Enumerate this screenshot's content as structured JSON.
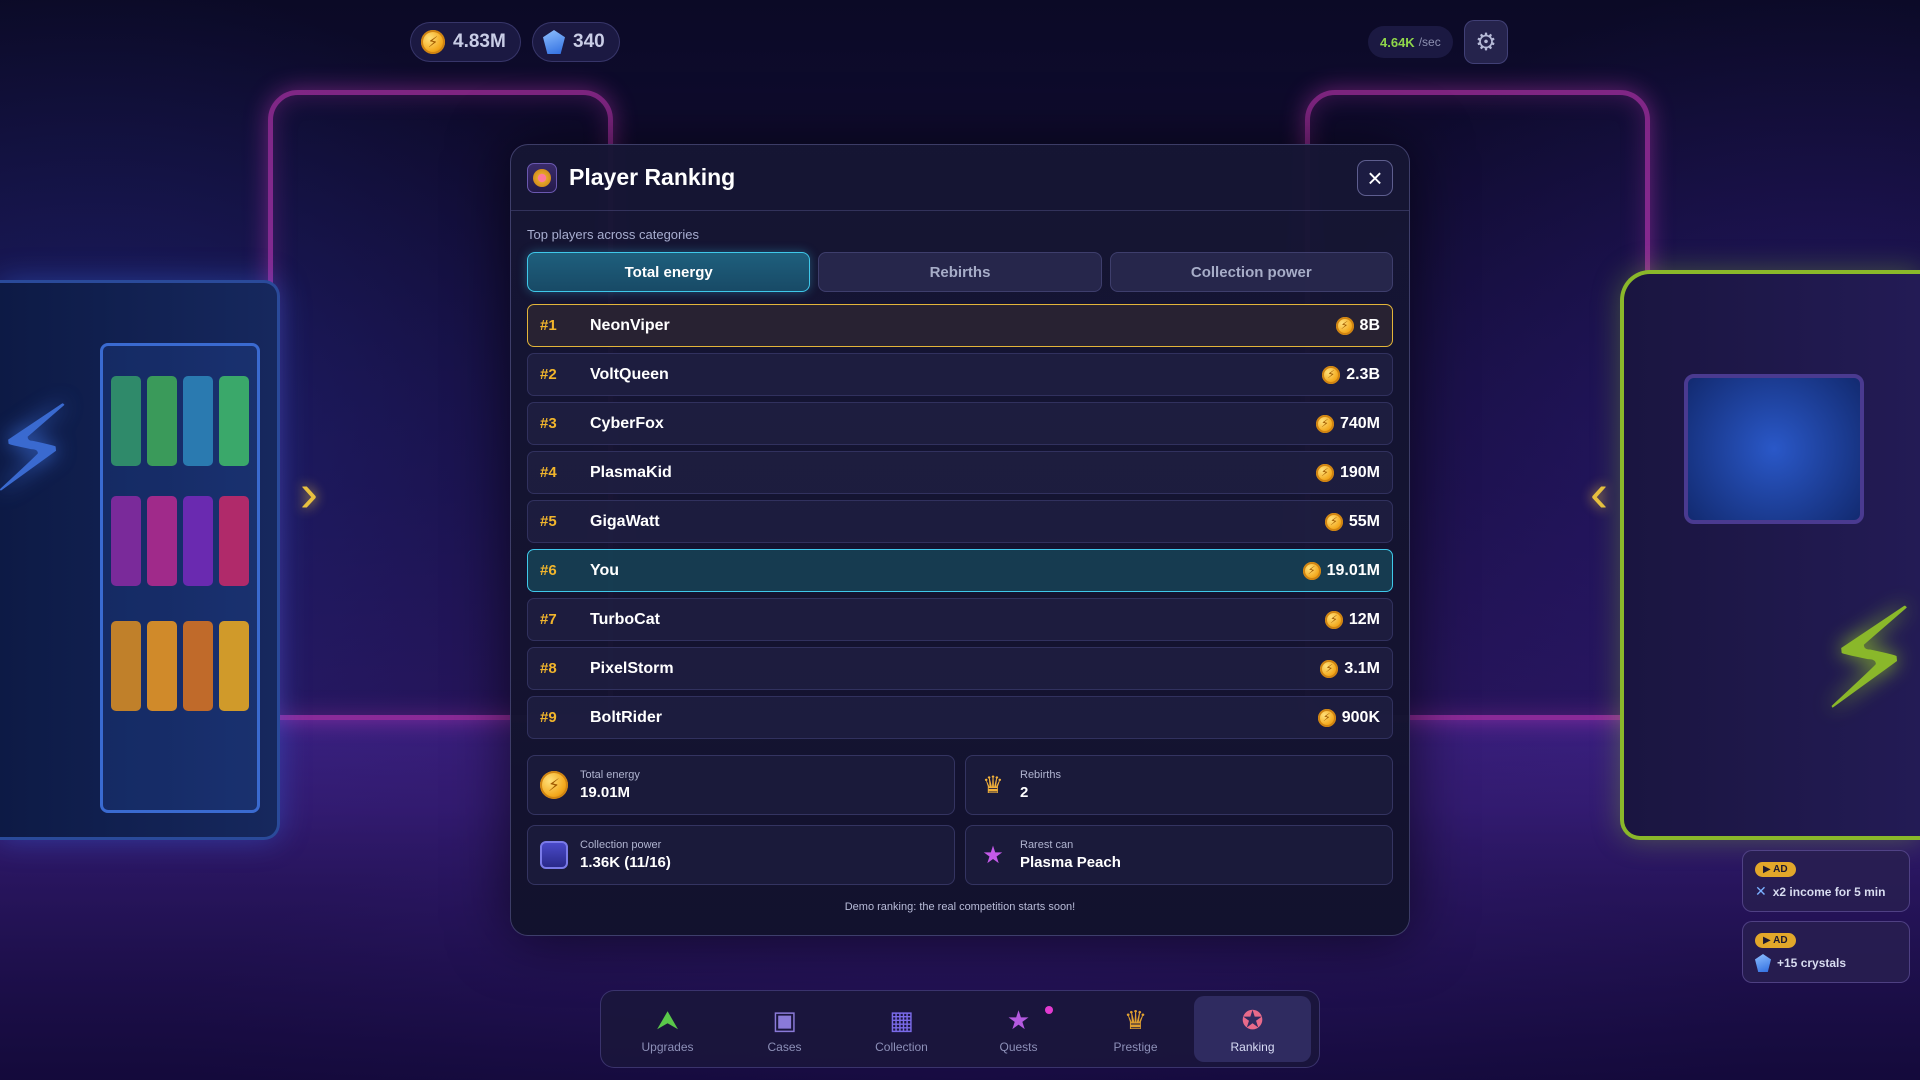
{
  "hud": {
    "coins": "4.83M",
    "crystals": "340",
    "rate_value": "4.64K",
    "rate_unit": "/sec",
    "settings_icon": "gear-icon"
  },
  "modal": {
    "title": "Player Ranking",
    "subtitle": "Top players across categories",
    "tabs": [
      {
        "label": "Total energy",
        "active": true
      },
      {
        "label": "Rebirths",
        "active": false
      },
      {
        "label": "Collection power",
        "active": false
      }
    ],
    "rankings": [
      {
        "rank": "#1",
        "name": "NeonViper",
        "score": "8B"
      },
      {
        "rank": "#2",
        "name": "VoltQueen",
        "score": "2.3B"
      },
      {
        "rank": "#3",
        "name": "CyberFox",
        "score": "740M"
      },
      {
        "rank": "#4",
        "name": "PlasmaKid",
        "score": "190M"
      },
      {
        "rank": "#5",
        "name": "GigaWatt",
        "score": "55M"
      },
      {
        "rank": "#6",
        "name": "You",
        "score": "19.01M"
      },
      {
        "rank": "#7",
        "name": "TurboCat",
        "score": "12M"
      },
      {
        "rank": "#8",
        "name": "PixelStorm",
        "score": "3.1M"
      },
      {
        "rank": "#9",
        "name": "BoltRider",
        "score": "900K"
      }
    ],
    "stats": [
      {
        "label": "Total energy",
        "value": "19.01M",
        "icon": "coin-icon"
      },
      {
        "label": "Rebirths",
        "value": "2",
        "icon": "crown-icon"
      },
      {
        "label": "Collection power",
        "value": "1.36K (11/16)",
        "icon": "box-icon"
      },
      {
        "label": "Rarest can",
        "value": "Plasma Peach",
        "icon": "star-icon"
      }
    ],
    "footer": "Demo ranking: the real competition starts soon!"
  },
  "ads": [
    {
      "badge": "▶ AD",
      "text": "x2 income for 5 min",
      "icon": "multiplier-icon"
    },
    {
      "badge": "▶ AD",
      "text": "+15 crystals",
      "icon": "crystal-icon"
    }
  ],
  "nav": [
    {
      "label": "Upgrades",
      "icon": "upgrade-arrow-icon"
    },
    {
      "label": "Cases",
      "icon": "case-icon"
    },
    {
      "label": "Collection",
      "icon": "collection-icon"
    },
    {
      "label": "Quests",
      "icon": "quest-star-icon"
    },
    {
      "label": "Prestige",
      "icon": "crown-icon"
    },
    {
      "label": "Ranking",
      "icon": "medal-icon"
    }
  ],
  "colors": {
    "accent": "#3fc8ea",
    "gold": "#e3b53a",
    "rank_number": "#f1b52c",
    "rate": "#8fd64a"
  }
}
